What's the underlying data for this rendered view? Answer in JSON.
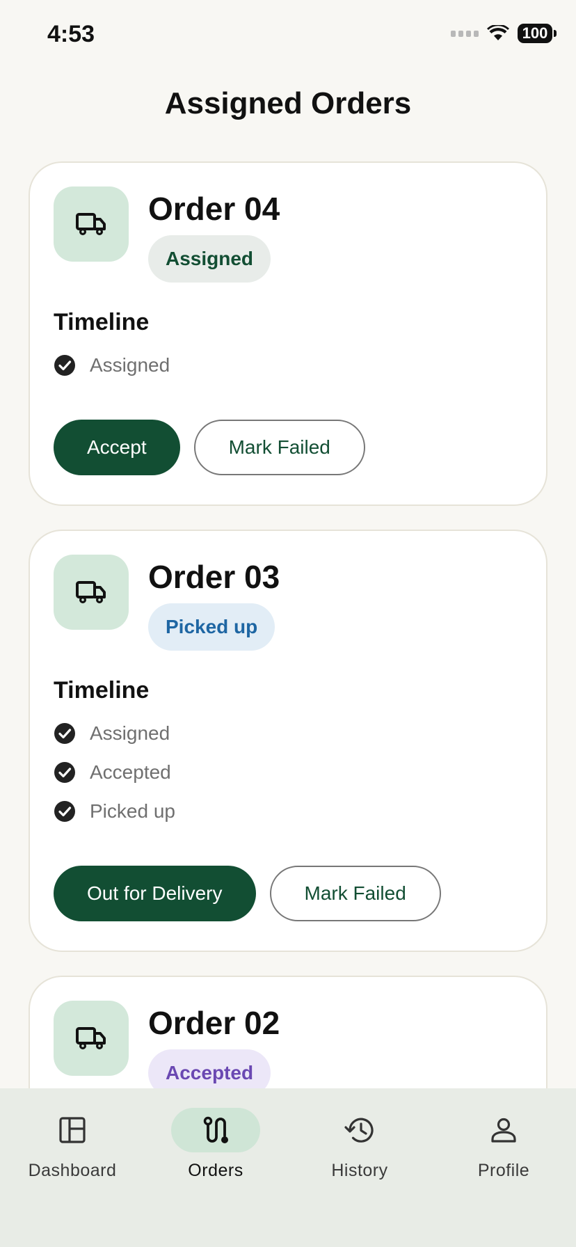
{
  "status_bar": {
    "time": "4:53",
    "battery": "100"
  },
  "header": {
    "title": "Assigned Orders"
  },
  "timeline_heading": "Timeline",
  "orders": [
    {
      "title": "Order 04",
      "status": "Assigned",
      "timeline": [
        "Assigned"
      ],
      "primary_action": "Accept",
      "secondary_action": "Mark Failed"
    },
    {
      "title": "Order 03",
      "status": "Picked up",
      "timeline": [
        "Assigned",
        "Accepted",
        "Picked up"
      ],
      "primary_action": "Out for Delivery",
      "secondary_action": "Mark Failed"
    },
    {
      "title": "Order 02",
      "status": "Accepted"
    }
  ],
  "nav": {
    "items": [
      {
        "label": "Dashboard",
        "icon": "dashboard-icon"
      },
      {
        "label": "Orders",
        "icon": "route-icon",
        "active": true
      },
      {
        "label": "History",
        "icon": "history-icon"
      },
      {
        "label": "Profile",
        "icon": "person-icon"
      }
    ]
  },
  "colors": {
    "primary": "#124e33",
    "background": "#f8f7f3",
    "tile": "#d3e8da",
    "nav_bg": "#e8ece6"
  }
}
